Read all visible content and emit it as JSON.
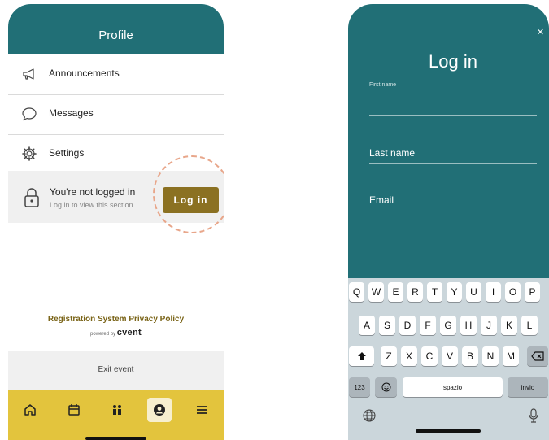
{
  "left_screen": {
    "header_title": "Profile",
    "menu": [
      {
        "label": "Announcements",
        "icon": "megaphone-icon"
      },
      {
        "label": "Messages",
        "icon": "chat-bubble-icon"
      },
      {
        "label": "Settings",
        "icon": "gear-icon"
      }
    ],
    "login_card": {
      "title": "You're not logged in",
      "subtitle": "Log in to view this section.",
      "button_label": "Log in"
    },
    "privacy_link": "Registration System Privacy Policy",
    "powered_by": "powered by",
    "powered_brand": "cvent",
    "exit_label": "Exit event",
    "tabbar": [
      {
        "icon": "home-icon",
        "active": false
      },
      {
        "icon": "calendar-icon",
        "active": false
      },
      {
        "icon": "people-icon",
        "active": false
      },
      {
        "icon": "profile-icon",
        "active": true
      },
      {
        "icon": "menu-icon",
        "active": false
      }
    ],
    "colors": {
      "header": "#216f76",
      "accent": "#8b7122",
      "tabbar": "#e3c43d"
    }
  },
  "right_screen": {
    "close_label": "×",
    "title": "Log in",
    "fields": [
      {
        "placeholder": "First name",
        "value": ""
      },
      {
        "placeholder": "Last name",
        "value": ""
      },
      {
        "placeholder": "Email",
        "value": ""
      }
    ],
    "keyboard": {
      "row1": [
        "Q",
        "W",
        "E",
        "R",
        "T",
        "Y",
        "U",
        "I",
        "O",
        "P"
      ],
      "row2": [
        "A",
        "S",
        "D",
        "F",
        "G",
        "H",
        "J",
        "K",
        "L"
      ],
      "row3": [
        "Z",
        "X",
        "C",
        "V",
        "B",
        "N",
        "M"
      ],
      "numbers_key": "123",
      "space_key": "spazio",
      "return_key": "invio"
    },
    "colors": {
      "background": "#216f76",
      "keyboard": "#cbd6db"
    }
  }
}
